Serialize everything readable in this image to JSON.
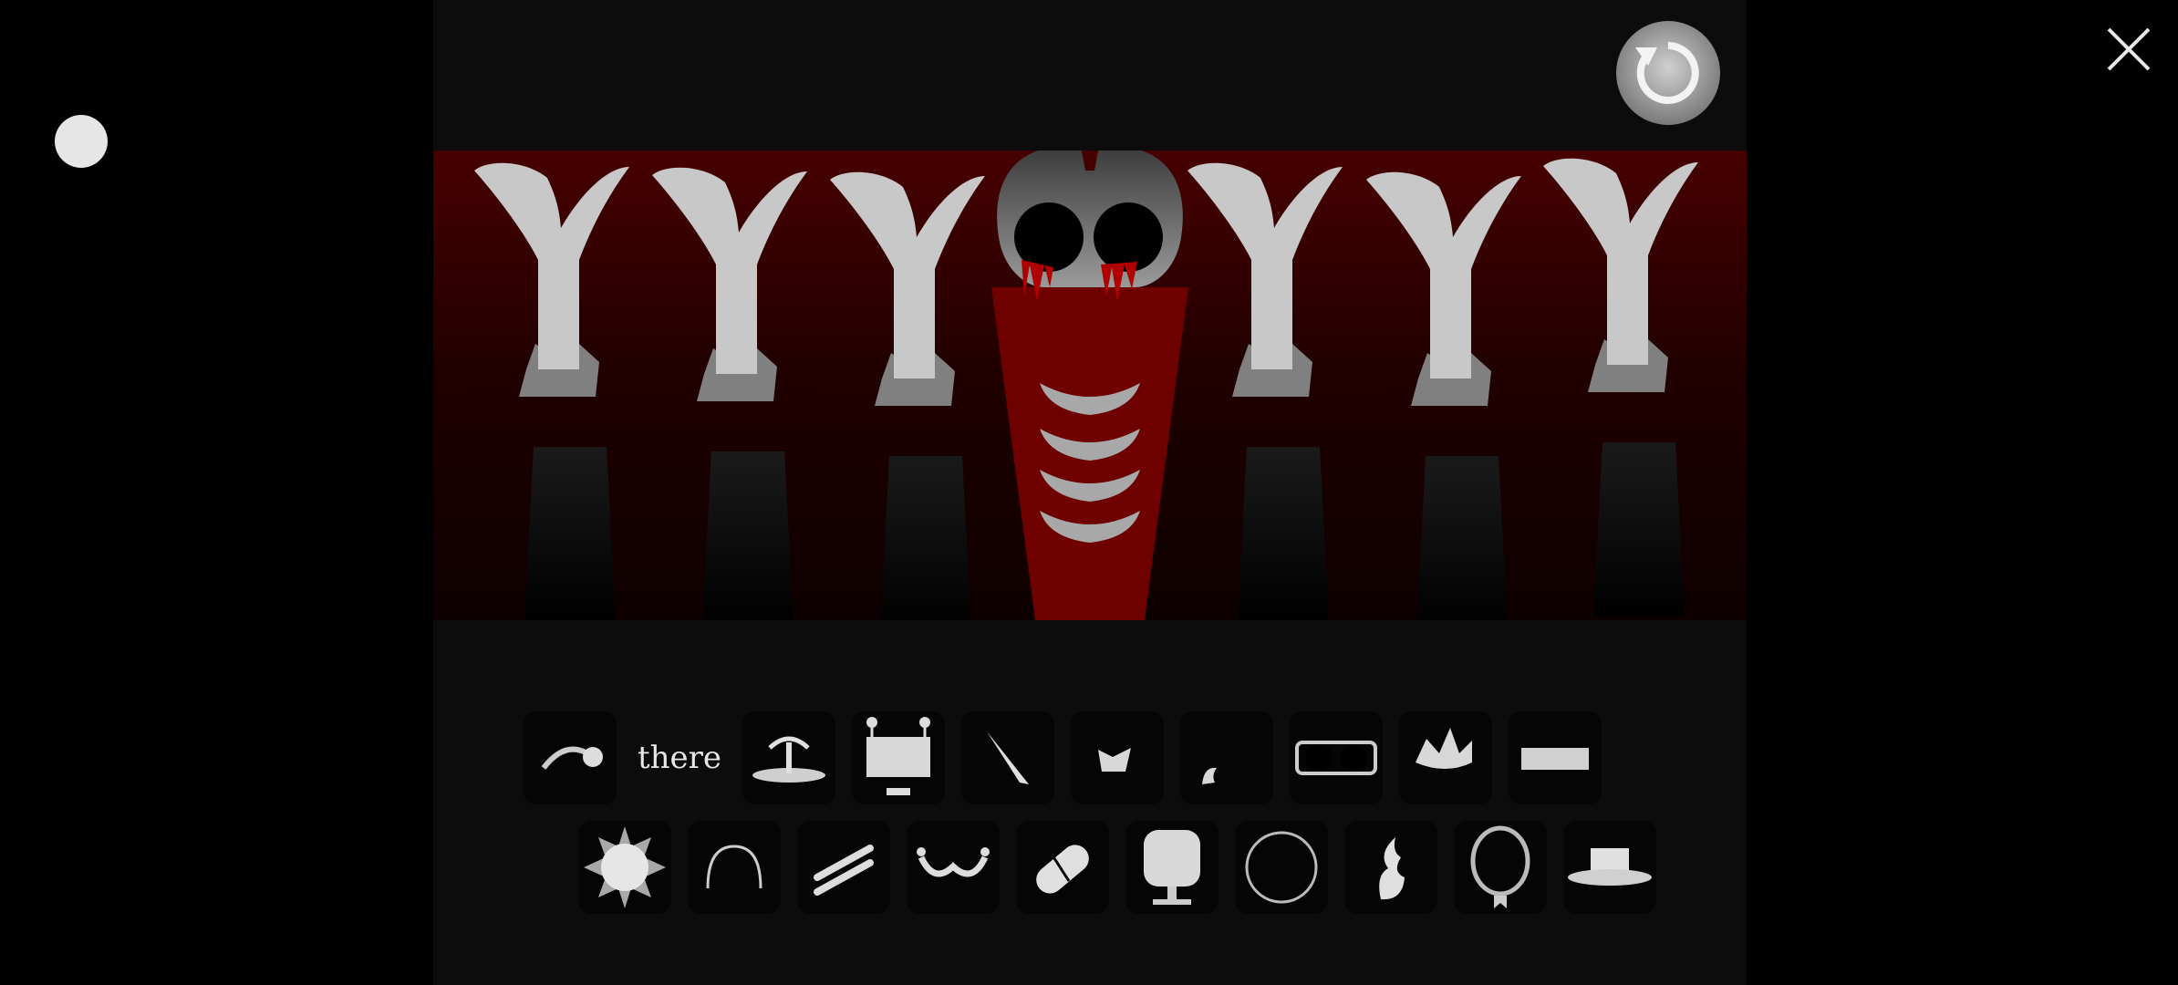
{
  "palette": {
    "accent": "#8b0000",
    "sprite": "#c8c8c8",
    "background": "#0c0c0c"
  },
  "top_left": {
    "icon": "circle-indicator"
  },
  "header": {
    "reset_icon": "refresh-icon",
    "close_icon": "close-icon"
  },
  "stage": {
    "characters": [
      {
        "name": "character-1",
        "icon": "y-head-sprite"
      },
      {
        "name": "character-2",
        "icon": "y-head-sprite"
      },
      {
        "name": "character-3",
        "icon": "y-head-sprite"
      },
      {
        "name": "character-4",
        "icon": "skull-sprite"
      },
      {
        "name": "character-5",
        "icon": "y-head-sprite"
      },
      {
        "name": "character-6",
        "icon": "y-head-sprite"
      },
      {
        "name": "character-7",
        "icon": "y-head-sprite"
      }
    ]
  },
  "palette_row1": [
    {
      "icon": "curve-arrow-icon"
    },
    {
      "label": "there"
    },
    {
      "icon": "fountain-icon"
    },
    {
      "icon": "monitor-antenna-icon"
    },
    {
      "icon": "blade-icon"
    },
    {
      "icon": "bird-icon"
    },
    {
      "icon": "hook-icon"
    },
    {
      "icon": "goggles-icon"
    },
    {
      "icon": "crown-icon"
    },
    {
      "icon": "bar-icon"
    }
  ],
  "palette_row2": [
    {
      "icon": "spiked-ball-icon"
    },
    {
      "icon": "arch-icon"
    },
    {
      "icon": "double-slash-icon"
    },
    {
      "icon": "mustache-icon"
    },
    {
      "icon": "pill-icon"
    },
    {
      "icon": "tv-screen-icon"
    },
    {
      "icon": "ring-icon"
    },
    {
      "icon": "flame-icon"
    },
    {
      "icon": "medal-icon"
    },
    {
      "icon": "hat-icon"
    }
  ]
}
